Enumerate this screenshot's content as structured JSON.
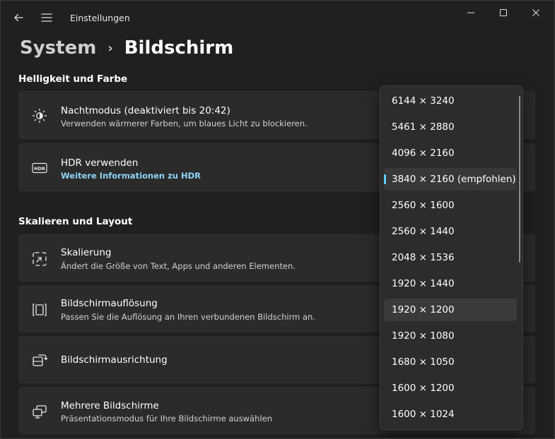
{
  "window": {
    "app_title": "Einstellungen",
    "icons": {
      "back": "back-arrow-icon",
      "menu": "hamburger-menu-icon",
      "minimize": "minimize-icon",
      "maximize": "maximize-icon",
      "close": "close-icon"
    }
  },
  "breadcrumb": {
    "parent": "System",
    "separator": "›",
    "current": "Bildschirm"
  },
  "sections": {
    "brightness": {
      "title": "Helligkeit und Farbe",
      "cards": [
        {
          "title": "Nachtmodus (deaktiviert bis 20:42)",
          "subtitle": "Verwenden wärmerer Farben, um blaues Licht zu blockieren.",
          "icon": "brightness-icon"
        },
        {
          "title": "HDR verwenden",
          "link": "Weitere Informationen zu HDR",
          "icon": "hdr-icon",
          "icon_text": "HDR"
        }
      ]
    },
    "layout": {
      "title": "Skalieren und Layout",
      "cards": [
        {
          "title": "Skalierung",
          "subtitle": "Ändert die Größe von Text, Apps und anderen Elementen.",
          "icon": "scale-icon"
        },
        {
          "title": "Bildschirmauflösung",
          "subtitle": "Passen Sie die Auflösung an Ihren verbundenen Bildschirm an.",
          "icon": "resolution-icon"
        },
        {
          "title": "Bildschirmausrichtung",
          "icon": "orientation-icon"
        },
        {
          "title": "Mehrere Bildschirme",
          "subtitle": "Präsentationsmodus für Ihre Bildschirme auswählen",
          "icon": "multiple-displays-icon"
        }
      ]
    }
  },
  "dropdown": {
    "options": [
      "6144 × 3240",
      "5461 × 2880",
      "4096 × 2160",
      "3840 × 2160 (empfohlen)",
      "2560 × 1600",
      "2560 × 1440",
      "2048 × 1536",
      "1920 × 1440",
      "1920 × 1200",
      "1920 × 1080",
      "1680 × 1050",
      "1600 × 1200",
      "1600 × 1024"
    ],
    "selected_index": 3,
    "hover_index": 8,
    "accent_color": "#60cdff"
  }
}
